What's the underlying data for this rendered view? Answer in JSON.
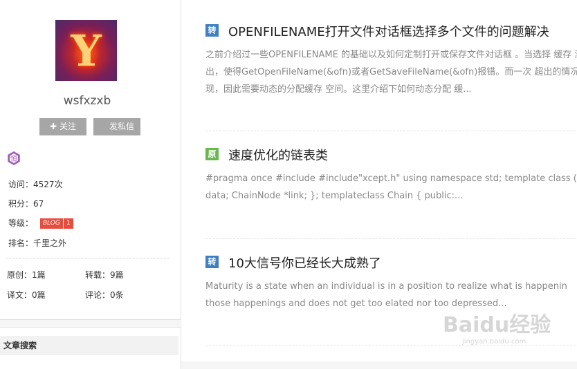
{
  "profile": {
    "username": "wsfxzxb",
    "follow_label": "关注",
    "message_label": "发私信",
    "badge_glyph": "恒",
    "stats": {
      "visits": "访问：4527次",
      "points": "积分：67",
      "level_label": "等级：",
      "level_badge_text": "BLOG",
      "level_badge_num": "1",
      "rank": "排名：千里之外"
    },
    "counts": {
      "original": "原创：1篇",
      "repost": "转载：9篇",
      "translation": "译文：0篇",
      "comments": "评论：0条"
    }
  },
  "search_card": {
    "title": "文章搜索"
  },
  "articles": [
    {
      "tag": "转",
      "title": "OPENFILENAME打开文件对话框选择多个文件的问题解决",
      "summary": "之前介绍过一些OPENFILENAME 的基础以及如何定制打开或保存文件对话框 。当选择 缓存 溢出，使得GetOpenFileName(&ofn)或者GetSaveFileName(&ofn)报错。而一次 超出的情况出现，因此需要动态的分配缓存 空间。这里介绍下如何动态分配 缓..."
    },
    {
      "tag": "原",
      "title": "速度优化的链表类",
      "summary": "#pragma once #include #include\"xcept.h\" using namespace std; template class ( data; ChainNode *link; }; templateclass Chain { public:..."
    },
    {
      "tag": "转",
      "title": "10大信号你已经长大成熟了",
      "summary": "Maturity is a state when an individual is in a position to realize what is happenin those happenings and does not get too elated nor too depressed..."
    }
  ],
  "watermark": {
    "main": "Baidu经验",
    "sub": "jingyan.baidu.com"
  },
  "colors": {
    "tag_repost": "#3d7fc2",
    "tag_original": "#67b84d",
    "level_badge": "#e84c3d",
    "button_gray": "#a6a6a6"
  }
}
